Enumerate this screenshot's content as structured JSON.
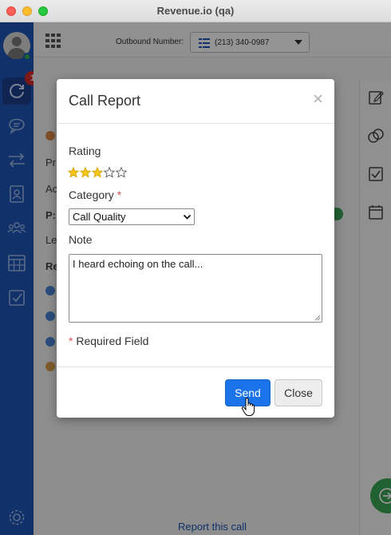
{
  "window": {
    "title": "Revenue.io (qa)"
  },
  "sidebar": {
    "notification_count": "1"
  },
  "toolbar": {
    "outbound_label": "Outbound Number:",
    "outbound_number": "(213) 340-0987"
  },
  "background": {
    "row_labels": [
      "Pr",
      "Ac",
      "P:",
      "Le",
      "Re"
    ]
  },
  "footer": {
    "report_link": "Report this call"
  },
  "modal": {
    "title": "Call Report",
    "close_glyph": "×",
    "rating_label": "Rating",
    "rating_value": 3,
    "rating_max": 5,
    "category_label": "Category",
    "category_required_mark": "*",
    "category_value": "Call Quality",
    "note_label": "Note",
    "note_value": "I heard echoing on the call...",
    "required_mark": "*",
    "required_text": "Required Field",
    "send_label": "Send",
    "close_label": "Close"
  },
  "colors": {
    "sidebar": "#1d55b5",
    "primary_button": "#1a73e8",
    "star_filled": "#f5c518",
    "required": "#d9534f",
    "badge": "#d52b2b"
  }
}
